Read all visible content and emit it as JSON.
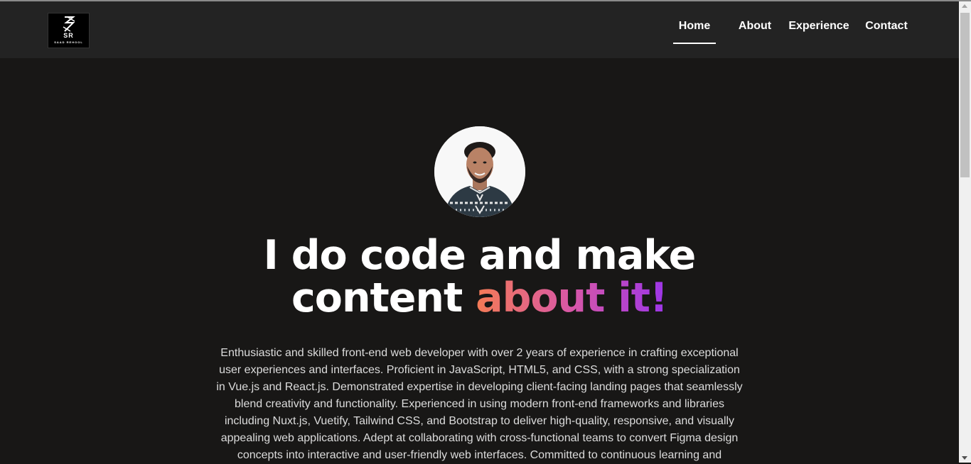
{
  "brand": {
    "initials": "SR",
    "name": "SAAD REHOOL"
  },
  "nav": {
    "items": [
      {
        "label": "Home",
        "active": true
      },
      {
        "label": "About",
        "active": false
      },
      {
        "label": "Experience",
        "active": false
      },
      {
        "label": "Contact",
        "active": false
      }
    ]
  },
  "hero": {
    "headline_line1": "I do code and make",
    "headline_line2_plain": "content ",
    "headline_line2_gradient": "about it!",
    "bio": "Enthusiastic and skilled front-end web developer with over 2 years of experience in crafting exceptional user experiences and interfaces. Proficient in JavaScript, HTML5, and CSS, with a strong specialization in Vue.js and React.js. Demonstrated expertise in developing client-facing landing pages that seamlessly blend creativity and functionality. Experienced in using modern front-end frameworks and libraries including Nuxt.js, Vuetify, Tailwind CSS, and Bootstrap to deliver high-quality, responsive, and visually appealing web applications. Adept at collaborating with cross-functional teams to convert Figma design concepts into interactive and user-friendly web interfaces. Committed to continuous learning and"
  },
  "colors": {
    "background": "#181716",
    "navbar": "#232323",
    "gradient_start": "#f47b55",
    "gradient_mid": "#d857a7",
    "gradient_end": "#9b35e8"
  }
}
